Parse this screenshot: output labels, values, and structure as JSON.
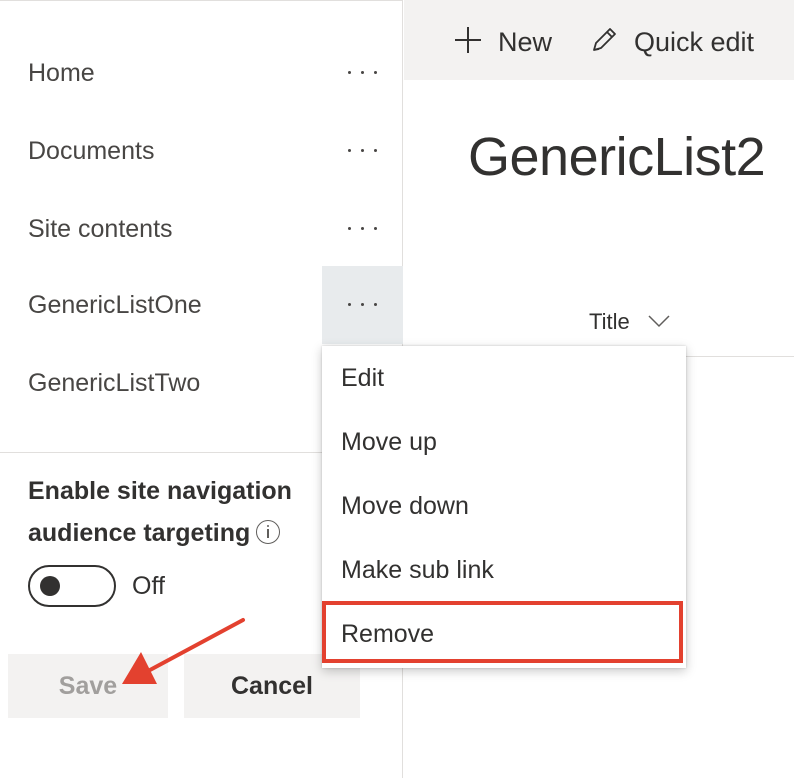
{
  "nav": {
    "items": [
      {
        "label": "Home"
      },
      {
        "label": "Documents"
      },
      {
        "label": "Site contents"
      },
      {
        "label": "GenericListOne"
      },
      {
        "label": "GenericListTwo"
      }
    ]
  },
  "audience_targeting": {
    "title": "Enable site navigation audience targeting",
    "title_line1": "Enable site navigation",
    "title_line2": "audience targeting",
    "toggle_state": "Off"
  },
  "actions": {
    "save_label": "Save",
    "cancel_label": "Cancel"
  },
  "command_bar": {
    "new_label": "New",
    "quick_edit_label": "Quick edit"
  },
  "list": {
    "title": "GenericList2",
    "column_header": "Title"
  },
  "context_menu": {
    "items": [
      {
        "label": "Edit"
      },
      {
        "label": "Move up"
      },
      {
        "label": "Move down"
      },
      {
        "label": "Make sub link"
      },
      {
        "label": "Remove",
        "highlighted": true
      }
    ]
  },
  "colors": {
    "highlight": "#e3412f",
    "active_button_bg": "#e8ebed",
    "command_bar_bg": "#f3f2f1"
  },
  "icons": {
    "new": "plus-icon",
    "quick_edit": "pencil-icon",
    "more": "more-options-icon",
    "info": "info-icon",
    "sort": "chevron-down-icon",
    "annotation": "red-arrow-icon"
  }
}
